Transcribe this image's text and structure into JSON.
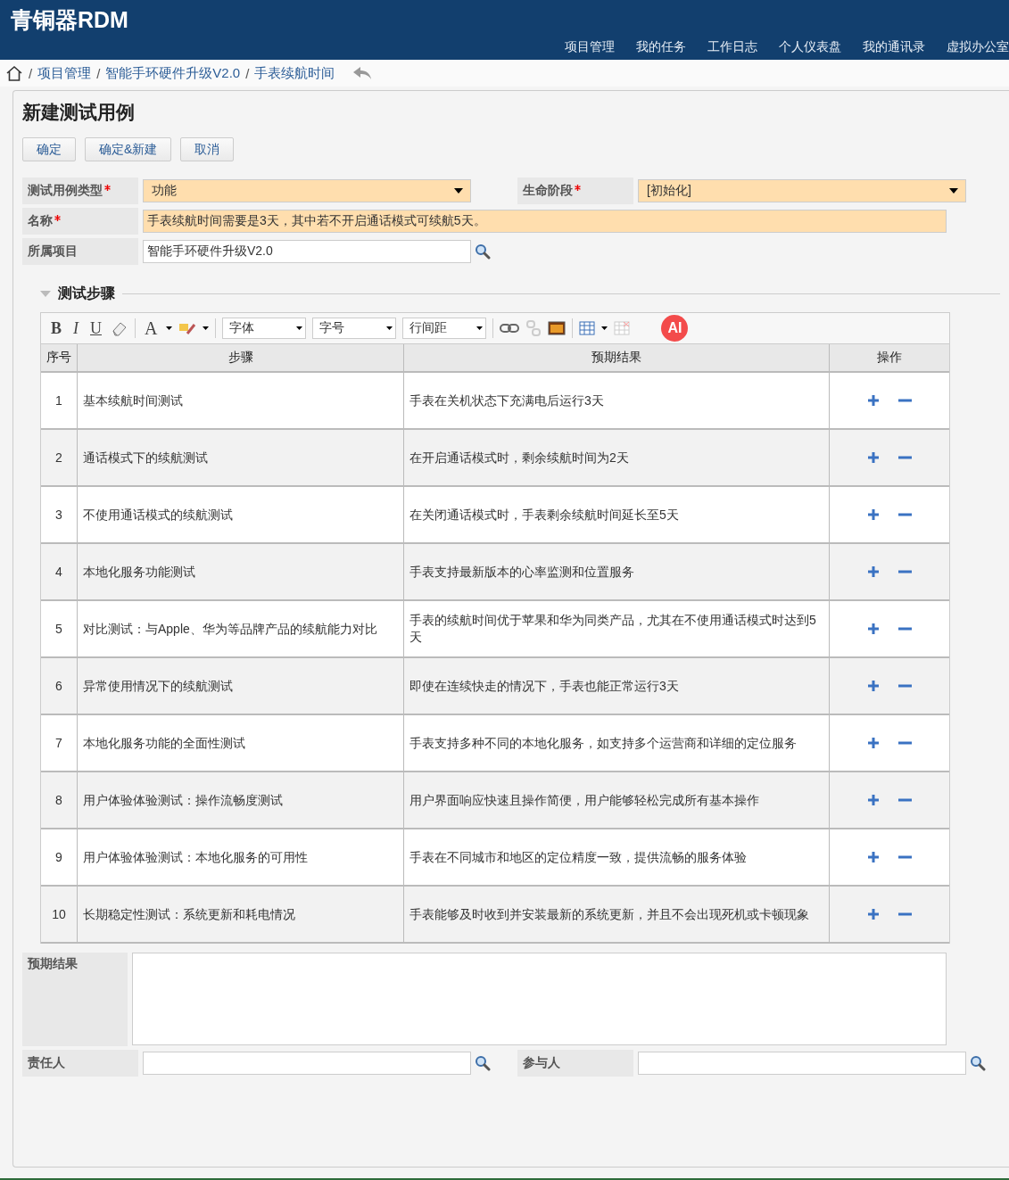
{
  "app_title": "青铜器RDM",
  "nav": [
    "项目管理",
    "我的任务",
    "工作日志",
    "个人仪表盘",
    "我的通讯录",
    "虚拟办公室"
  ],
  "breadcrumb": [
    "项目管理",
    "智能手环硬件升级V2.0",
    "手表续航时间"
  ],
  "breadcrumb_separator": "/",
  "page_title": "新建测试用例",
  "buttons": [
    "确定",
    "确定&新建",
    "取消"
  ],
  "fields": [
    {
      "label": "测试用例类型",
      "required": true,
      "kind": "select",
      "value": "功能",
      "highlight": true
    },
    {
      "label": "生命阶段",
      "required": true,
      "kind": "select",
      "value": "[初始化]",
      "highlight": true
    },
    {
      "label": "名称",
      "required": true,
      "kind": "text",
      "value": "手表续航时间需要是3天，其中若不开启通话模式可续航5天。",
      "highlight": true
    },
    {
      "label": "所属项目",
      "required": false,
      "kind": "lookup",
      "value": "智能手环硬件升级V2.0",
      "highlight": false
    }
  ],
  "section": {
    "title": "测试步骤",
    "expanded": true
  },
  "toolbar": {
    "format_buttons": [
      "B",
      "I",
      "U"
    ],
    "font_color": "A",
    "dropdowns": [
      "字体",
      "字号",
      "行间距"
    ],
    "ai_badge": "AI"
  },
  "table": {
    "columns": [
      "序号",
      "步骤",
      "预期结果",
      "操作"
    ],
    "rows": [
      {
        "index": "1",
        "step": "基本续航时间测试",
        "expected": "手表在关机状态下充满电后运行3天"
      },
      {
        "index": "2",
        "step": "通话模式下的续航测试",
        "expected": "在开启通话模式时，剩余续航时间为2天"
      },
      {
        "index": "3",
        "step": "不使用通话模式的续航测试",
        "expected": "在关闭通话模式时，手表剩余续航时间延长至5天"
      },
      {
        "index": "4",
        "step": "本地化服务功能测试",
        "expected": "手表支持最新版本的心率监测和位置服务"
      },
      {
        "index": "5",
        "step": "对比测试：与Apple、华为等品牌产品的续航能力对比",
        "expected": "手表的续航时间优于苹果和华为同类产品，尤其在不使用通话模式时达到5天"
      },
      {
        "index": "6",
        "step": "异常使用情况下的续航测试",
        "expected": "即使在连续快走的情况下，手表也能正常运行3天"
      },
      {
        "index": "7",
        "step": "本地化服务功能的全面性测试",
        "expected": "手表支持多种不同的本地化服务，如支持多个运营商和详细的定位服务"
      },
      {
        "index": "8",
        "step": "用户体验体验测试：操作流畅度测试",
        "expected": "用户界面响应快速且操作简便，用户能够轻松完成所有基本操作"
      },
      {
        "index": "9",
        "step": "用户体验体验测试：本地化服务的可用性",
        "expected": "手表在不同城市和地区的定位精度一致，提供流畅的服务体验"
      },
      {
        "index": "10",
        "step": "长期稳定性测试：系统更新和耗电情况",
        "expected": "手表能够及时收到并安装最新的系统更新，并且不会出现死机或卡顿现象"
      }
    ]
  },
  "bottom_fields": [
    {
      "label": "预期结果",
      "kind": "textarea"
    },
    {
      "label": "责任人",
      "kind": "lookup"
    },
    {
      "label": "参与人",
      "kind": "lookup"
    }
  ]
}
